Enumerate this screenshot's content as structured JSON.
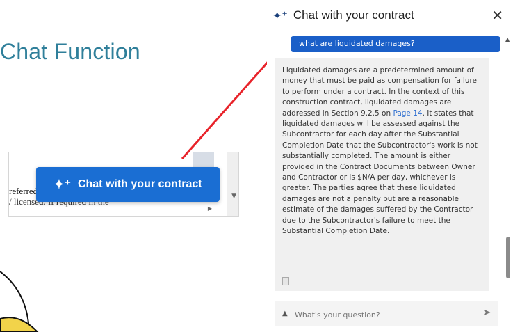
{
  "slide": {
    "title": "Chat Function"
  },
  "doc": {
    "line1": "referred",
    "line2": "/ licensed. If required in the"
  },
  "floating_button": {
    "label": "Chat with your contract",
    "icon": "sparkle-icon"
  },
  "chat": {
    "header_title": "Chat with your contract",
    "header_icon": "sparkle-icon",
    "close_icon": "close-icon",
    "user_message": "what are liquidated damages?",
    "answer_before_link": "Liquidated damages are a predetermined amount of money that must be paid as compensation for failure to perform under a contract. In the context of this construction contract, liquidated damages are addressed in Section 9.2.5 on ",
    "answer_link": "Page 14",
    "answer_after_link": ". It states that liquidated damages will be assessed against the Subcontractor for each day after the Substantial Completion Date that the Subcontractor's work is not substantially completed. The amount is either provided in the Contract Documents between Owner and Contractor or is $N/A per day, whichever is greater. The parties agree that these liquidated damages are not a penalty but are a reasonable estimate of the damages suffered by the Contractor due to the Subcontractor's failure to meet the Substantial Completion Date.",
    "input_placeholder": "What's your question?"
  },
  "colors": {
    "title": "#2f7f9a",
    "button": "#1a6ed3",
    "user_bubble": "#1a5fc8",
    "arrow": "#e8232a",
    "link": "#2f6fd0"
  }
}
